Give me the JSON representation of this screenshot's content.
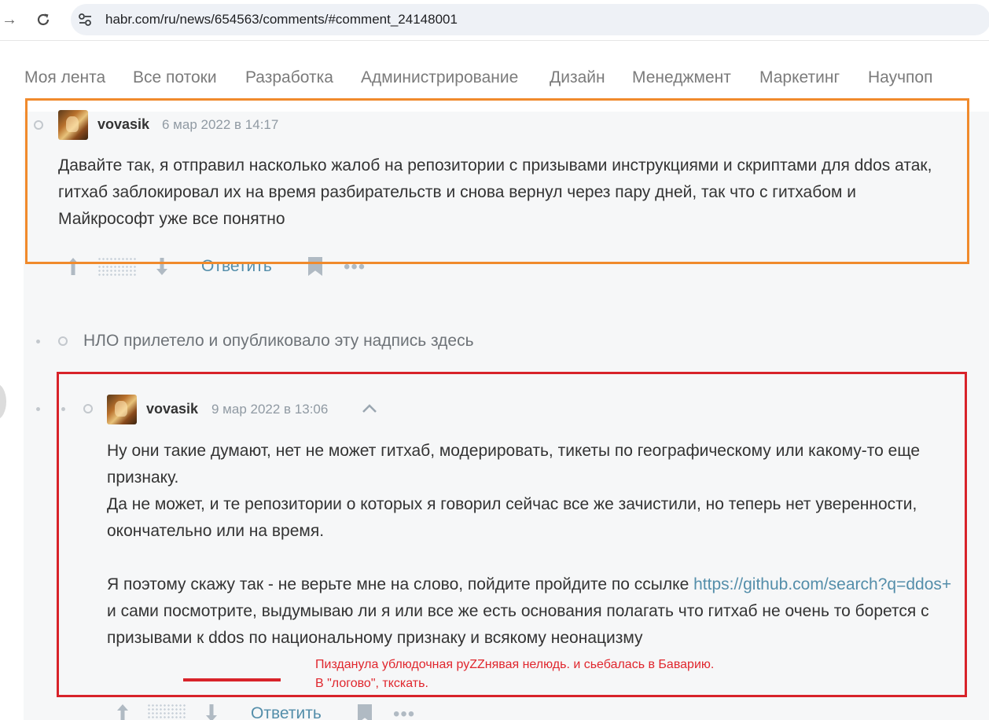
{
  "browser": {
    "back_icon": "arrow-right-icon",
    "reload_icon": "reload-icon",
    "site_info_icon": "tune-icon",
    "url": "habr.com/ru/news/654563/comments/#comment_24148001"
  },
  "nav": {
    "items": [
      "Моя лента",
      "Все потоки",
      "Разработка",
      "Администрирование",
      "Дизайн",
      "Менеджмент",
      "Маркетинг",
      "Научпоп"
    ]
  },
  "comments": [
    {
      "author": "vovasik",
      "time": "6 мар 2022 в 14:17",
      "text": "Давайте так, я отправил насколько жалоб на репозитории с призывами инструкциями и скриптами для ddos атак, гитхаб заблокировал их на время разбирательств и снова вернул через пару дней, так что с гитхабом и Майкрософт уже все понятно",
      "reply_label": "Ответить"
    },
    {
      "author": "vovasik",
      "time": "9 мар 2022 в 13:06",
      "paragraph1": "Ну они такие думают, нет не может гитхаб, модерировать, тикеты по географическому или какому-то еще признаку.",
      "paragraph2": "Да не может, и те репозитории о которых я говорил сейчас все же зачистили, но теперь нет уверенности, окончательно или на время.",
      "paragraph3_before": "Я поэтому скажу так - не верьте мне на слово, пойдите пройдите по ссылке ",
      "paragraph3_link": "https://github.com/search?q=ddos+",
      "paragraph3_after": " и сами посмотрите, выдумываю ли я или все же есть основания полагать что гитхаб не очень то борется с призывами к ddos по национальному признаку и всякому ",
      "paragraph3_underlined": "неонацизму",
      "reply_label": "Ответить"
    }
  ],
  "ufo_message": "НЛО прилетело и опубликовало эту надпись здесь",
  "annotation": {
    "note_line1": "Пизданула ублюдочная руZZнявая нелюдь. и сьебалась в Баварию.",
    "note_line2": "В \"логово\", ткскать."
  },
  "colors": {
    "link": "#548eaa",
    "orange_box": "#f08a2c",
    "red_box": "#d8232a",
    "muted": "#909aa3"
  }
}
